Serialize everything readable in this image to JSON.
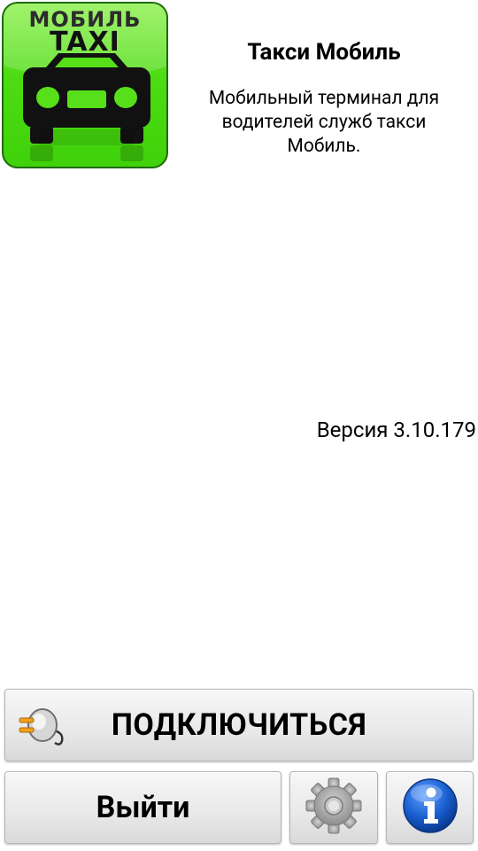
{
  "logo": {
    "top_text": "МОБИЛЬ",
    "taxi_text": "TAXI"
  },
  "app": {
    "title": "Такси Мобиль",
    "description": "Мобильный терминал для\nводителей служб такси\nМобиль.",
    "version": "Версия 3.10.179"
  },
  "buttons": {
    "connect_label": "ПОДКЛЮЧИТЬСЯ",
    "exit_label": "Выйти",
    "connect_icon": "plug-icon",
    "settings_icon": "gear-icon",
    "info_icon": "info-icon"
  },
  "colors": {
    "logo_green": "#4ddc12",
    "info_blue": "#1a5fd0",
    "gear_gray": "#9a9a9a"
  }
}
